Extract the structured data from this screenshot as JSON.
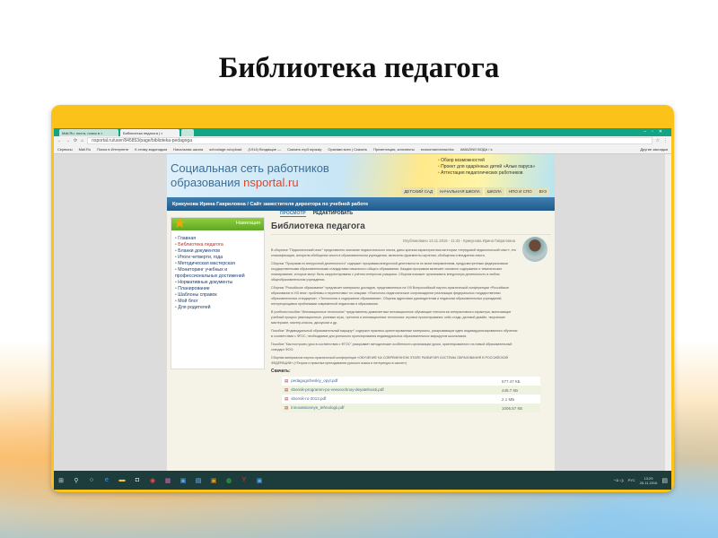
{
  "slide_title": "Библиотека педагога",
  "browser": {
    "tabs": [
      "Mail.Ru: почта, поиск в ×",
      "Библиотека педагога | ×"
    ],
    "url": "nsportal.ru/user/845853/page/biblioteka-pedagoga",
    "bookmarks": [
      "Сервисы",
      "Mail.Ru",
      "Поиск в Интернете",
      "К стиму водопадом",
      "Начальная школа",
      "schoolage.ru/upload",
      "(1914) Входящие —",
      "Скачать mp3 музыку",
      "Оригами всех | Скачать",
      "Презентации, конспекты",
      "ecosoman/oesru/doc",
      "AMAZING ВОДА / s"
    ],
    "other_bookmarks": "Другие закладки"
  },
  "site": {
    "logo_line1": "Социальная сеть работников",
    "logo_line2_prefix": "образования ",
    "logo_brand": "nsportal.ru",
    "promo": [
      "Обзор возможностей",
      "Проект для одарённых детей «Алые паруса»",
      "Аттестация педагогических работников"
    ],
    "level_tabs": [
      "ДЕТСКИЙ САД",
      "НАЧАЛЬНАЯ ШКОЛА",
      "ШКОЛА",
      "НПО И СПО",
      "ВУЗ"
    ],
    "breadcrumb": "Крикунова Ирина Гавриловна / Сайт заместителя директора по учебной работе",
    "nav_title": "Навигация",
    "nav": [
      "Главная",
      "Библиотека педагога",
      "Бланки документов",
      "Итоги четверти, года",
      "Методическая мастерская",
      "Мониторинг учебных и профессиональных достижений",
      "Нормативные документы",
      "Планирование",
      "Шаблоны справок",
      "Мой блог",
      "Для родителей"
    ],
    "view_tabs": [
      "ПРОСМОТР",
      "РЕДАКТИРОВАТЬ"
    ],
    "page_title": "Библиотека педагога",
    "meta": "Опубликовано 13.11.2016 - 11:43 - Крикунова Ирина Гавриловна",
    "paragraphs": [
      "В сборнике \"Педагогический опыт\" представлено описание педагогического опыта, даны краткая характеристика категории «передовой педагогический опыт», его классификация, алгоритм обобщения опыта в образовательном учреждении, включены фрагменты изучения, обобщения и вне­дрения опыта.",
      "Сборник \"Программ по внеурочной деятельности\" содержит программы внеурочной деятельности по всем направлениям, предусмотренным федеральными государственными образовательными стандартами начального общего образования. Каждая программа включает основное содержание и тематическое планирование, которые могут быть скорректированы с учётом интересов учащихся. Сборник поможет организовать внеурочную деятельность в любом общеобразовательном учреждении.",
      "Сборник \"Российское образование\" предлагает материалы докладов, представленных на VIII Всероссийской научно-практической конференции «Российское образование в XXI веке: проблемы и перспективы» по секциям: «Психолого-педагогическое сопровождение реализации федеральных государственных образовательных стандартов», «Технологии и содержание образования». Сборник адресован руководителям и педагогам образовательных учреждений, интересующимся проблемами современной педагогики и образования.",
      "В учебном пособии \"Инновационные технологии\" представлены доминантные инновационные обучающие технологии интерактивного характера, включающие учебный процесс (имитационные, ролевые игры, тренинги и инновационные технологии: игровое проектирование, кейс-стади, деловой дизайн, творческие мастерские, мастер-классы, дискуссии и др.",
      "Пособие \"Индивидуальный образовательный маршрут\" содержит практико-ориентированные материалы, раскрывающие идею индивидуализированного обучения в соответствии с ФГОС, необходимые для успешного проектирования индивидуальных образовательных маршрутов школьников.",
      "Пособие \"Как построить урок в соответствии с ФГОС\" раскрывает методические особенности организации урока, ориентированного на новый образовательный стандарт ФОО.",
      "Сборник материалов научно-практической конференции «ОБУЧЕНИЕ НА СОВРЕМЕННОМ ЭТАПЕ РАЗВИТИЯ СИСТЕМЫ ОБРАЗОВАНИЯ В РОССИЙСКОЙ ФЕДЕРАЦИИ» («Теория и практика преподавания русского языка и литературы в школе»)"
    ],
    "download_label": "Скачать:",
    "files": [
      {
        "name": "pedagogicheskiy_opyt.pdf",
        "size": "577.47 КБ"
      },
      {
        "name": "sbornik-programm-po-vneurochnoy-deyatelnosti.pdf",
        "size": "449.7 КБ"
      },
      {
        "name": "sbornik-ro-2013.pdf",
        "size": "2.1 МБ"
      },
      {
        "name": "innovatsionnye_tehnologii.pdf",
        "size": "1006.57 КБ"
      }
    ]
  },
  "taskbar": {
    "lang": "РУС",
    "time": "13:29",
    "date": "26.11.2016"
  }
}
